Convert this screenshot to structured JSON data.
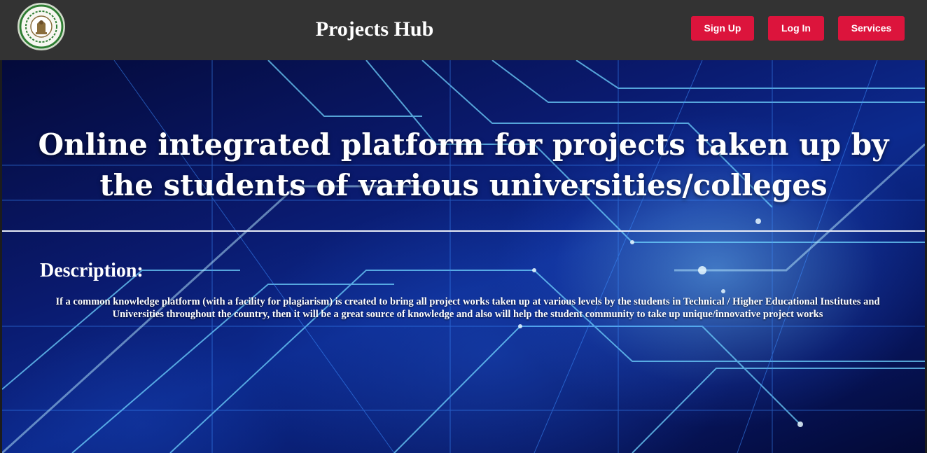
{
  "header": {
    "site_title": "Projects Hub",
    "buttons": {
      "signup": "Sign Up",
      "login": "Log In",
      "services": "Services"
    }
  },
  "hero": {
    "heading_line1": "Online integrated platform for projects taken up by",
    "heading_line2": "the students of various universities/colleges",
    "description_title": "Description:",
    "description_text": "If a common knowledge platform (with a facility for plagiarism) is created to bring all project works taken up at various levels by the students in Technical / Higher Educational Institutes and Universities throughout the country, then it will be a great source of knowledge and also will help the student community to take up unique/innovative project works"
  },
  "colors": {
    "header_bg": "#333333",
    "button_bg": "#dc143c",
    "text": "#ffffff",
    "hero_base": "#0a1a6e"
  },
  "icons": {
    "logo": "government-emblem-seal-icon"
  }
}
